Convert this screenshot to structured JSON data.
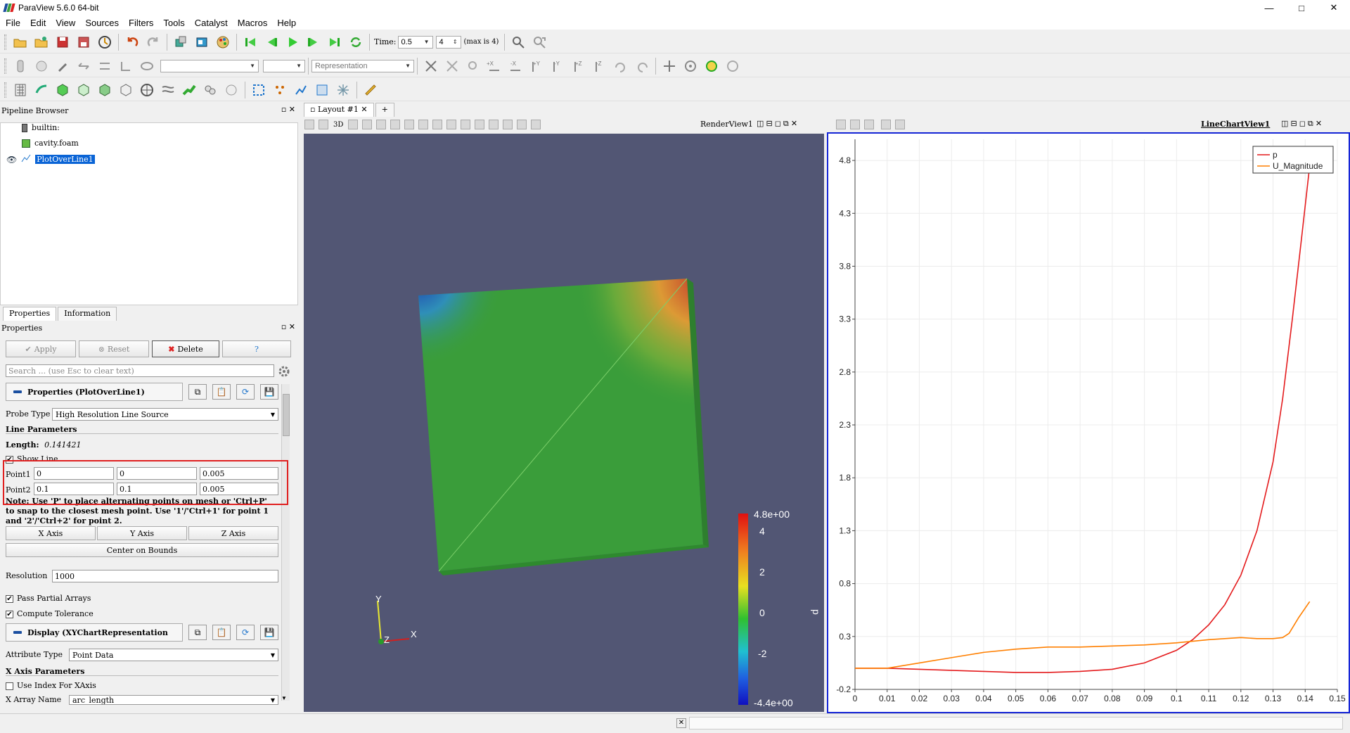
{
  "window": {
    "title": "ParaView 5.6.0 64-bit",
    "controls": [
      "—",
      "□",
      "✕"
    ]
  },
  "menu": [
    "File",
    "Edit",
    "View",
    "Sources",
    "Filters",
    "Tools",
    "Catalyst",
    "Macros",
    "Help"
  ],
  "time_toolbar": {
    "time_label": "Time:",
    "time_value": "0.5",
    "step_value": "4",
    "max_label": "(max is 4)"
  },
  "toolbar2": {
    "representation": "Representation"
  },
  "pipeline": {
    "header": "Pipeline Browser",
    "items": [
      "builtin:",
      "cavity.foam",
      "PlotOverLine1"
    ]
  },
  "left_tabs": [
    "Properties",
    "Information"
  ],
  "properties": {
    "header": "Properties",
    "apply": "Apply",
    "reset": "Reset",
    "delete": "Delete",
    "help": "?",
    "search_placeholder": "Search ... (use Esc to clear text)",
    "section_title": "Properties (PlotOverLine1)",
    "probe_type_label": "Probe Type",
    "probe_type_value": "High Resolution Line Source",
    "line_params": "Line Parameters",
    "length_label": "Length:",
    "length_value": "0.141421",
    "show_line": "Show Line",
    "point1_label": "Point1",
    "point1": [
      "0",
      "0",
      "0.005"
    ],
    "point2_label": "Point2",
    "point2": [
      "0.1",
      "0.1",
      "0.005"
    ],
    "note": "Note: Use 'P' to place alternating points on mesh or 'Ctrl+P' to snap to the closest mesh point. Use '1'/'Ctrl+1' for point 1 and '2'/'Ctrl+2' for point 2.",
    "x_axis": "X Axis",
    "y_axis": "Y Axis",
    "z_axis": "Z Axis",
    "center_bounds": "Center on Bounds",
    "resolution_label": "Resolution",
    "resolution_value": "1000",
    "pass_partial": "Pass Partial Arrays",
    "compute_tol": "Compute Tolerance",
    "display_title": "Display (XYChartRepresentation",
    "attribute_label": "Attribute Type",
    "attribute_value": "Point Data",
    "x_axis_params": "X Axis Parameters",
    "use_index": "Use Index For XAxis",
    "x_array_label": "X Array Name",
    "x_array_value": "arc_length"
  },
  "layout": {
    "tab": "Layout #1",
    "plus": "+"
  },
  "render_view": {
    "name": "RenderView1",
    "mode": "3D",
    "bg_color": "#525674",
    "colorbar": {
      "title": "p",
      "labels": [
        "4.8e+00",
        "4",
        "2",
        "0",
        "-2",
        "-4.4e+00"
      ]
    },
    "axes": {
      "y": "Y",
      "z": "Z",
      "x": "X"
    }
  },
  "chart_view": {
    "name": "LineChartView1"
  },
  "chart_data": {
    "type": "line",
    "xlim": [
      0,
      0.15
    ],
    "ylim": [
      -0.2,
      5.0
    ],
    "x_ticks": [
      "0",
      "0.01",
      "0.02",
      "0.03",
      "0.04",
      "0.05",
      "0.06",
      "0.07",
      "0.08",
      "0.09",
      "0.1",
      "0.11",
      "0.12",
      "0.13",
      "0.14",
      "0.15"
    ],
    "y_ticks": [
      "-0.2",
      "0.3",
      "0.8",
      "1.3",
      "1.8",
      "2.3",
      "2.8",
      "3.3",
      "3.8",
      "4.3",
      "4.8"
    ],
    "grid": true,
    "legend_position": "top-right",
    "series": [
      {
        "name": "p",
        "color": "#e41a1c",
        "x": [
          0,
          0.01,
          0.02,
          0.03,
          0.04,
          0.05,
          0.06,
          0.07,
          0.08,
          0.09,
          0.1,
          0.105,
          0.11,
          0.115,
          0.12,
          0.125,
          0.13,
          0.133,
          0.136,
          0.139,
          0.1414
        ],
        "y": [
          0.0,
          0.0,
          -0.01,
          -0.02,
          -0.03,
          -0.04,
          -0.04,
          -0.03,
          -0.01,
          0.05,
          0.17,
          0.27,
          0.41,
          0.6,
          0.88,
          1.3,
          1.95,
          2.55,
          3.3,
          4.1,
          4.75
        ]
      },
      {
        "name": "U_Magnitude",
        "color": "#ff7f00",
        "x": [
          0,
          0.01,
          0.02,
          0.03,
          0.04,
          0.05,
          0.06,
          0.07,
          0.08,
          0.09,
          0.1,
          0.11,
          0.12,
          0.125,
          0.13,
          0.133,
          0.135,
          0.138,
          0.1414
        ],
        "y": [
          0.0,
          0.0,
          0.05,
          0.1,
          0.15,
          0.18,
          0.2,
          0.2,
          0.21,
          0.22,
          0.24,
          0.27,
          0.29,
          0.28,
          0.28,
          0.29,
          0.33,
          0.48,
          0.63
        ]
      }
    ]
  }
}
